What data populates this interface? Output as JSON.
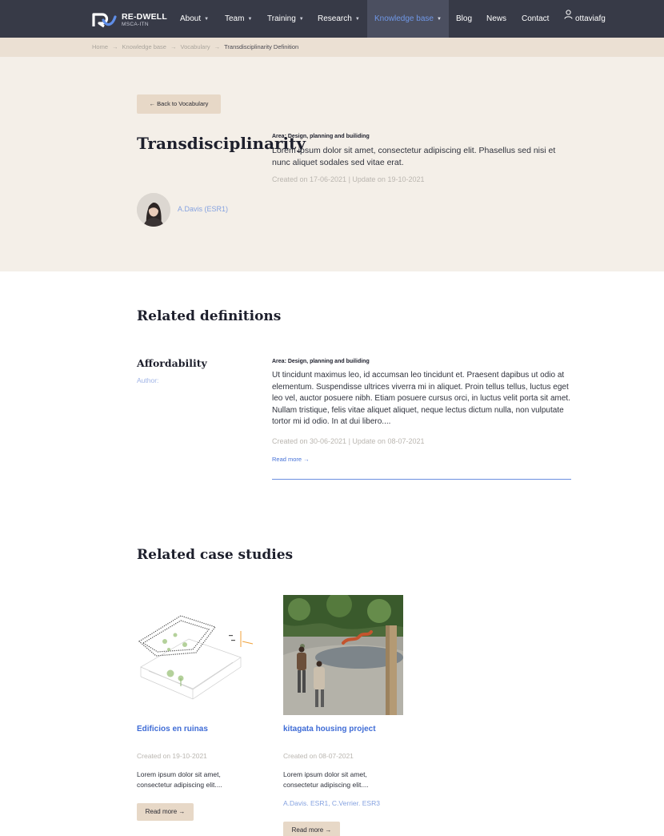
{
  "nav": {
    "brand_title": "RE-DWELL",
    "brand_subtitle": "MSCA-ITN",
    "items": [
      {
        "label": "About"
      },
      {
        "label": "Team"
      },
      {
        "label": "Training"
      },
      {
        "label": "Research"
      },
      {
        "label": "Knowledge base"
      },
      {
        "label": "Blog"
      },
      {
        "label": "News"
      },
      {
        "label": "Contact"
      }
    ],
    "dropdown_caret": "▼",
    "user_icon": "user-icon",
    "user": "ottaviafg",
    "colors": {
      "bar": "#373a47",
      "active_text": "#6f97e6"
    }
  },
  "breadcrumb": {
    "items": [
      "Home",
      "Knowledge base",
      "Vocabulary",
      "Transdisciplinarity Definition"
    ],
    "separator": "→"
  },
  "term": {
    "back_label": "← Back to Vocabulary",
    "title": "Transdisciplinarity",
    "area": "Area: Design, planning and builiding",
    "description": "Lorem ipsum dolor sit amet, consectetur adipiscing elit. Phasellus sed nisi et nunc aliquet sodales sed vitae erat.",
    "dates": "Created on 17-06-2021 | Update on 19-10-2021",
    "author": "A.Davis (ESR1)"
  },
  "related_definitions": {
    "heading": "Related definitions",
    "items": [
      {
        "title": "Affordability",
        "author_label": "Author:",
        "area": "Area: Design, planning and builiding",
        "text": "Ut tincidunt maximus leo, id accumsan leo tincidunt et. Praesent dapibus ut odio at elementum. Suspendisse ultrices viverra mi in aliquet. Proin tellus tellus, luctus eget leo vel, auctor posuere nibh. Etiam posuere cursus orci, in luctus velit porta sit amet. Nullam tristique, felis vitae aliquet aliquet, neque lectus dictum nulla, non vulputate tortor mi id odio. In at dui libero....",
        "dates": "Created on 30-06-2021 | Update on 08-07-2021",
        "read_more": "Read more →"
      }
    ]
  },
  "related_case_studies": {
    "heading": "Related case studies",
    "items": [
      {
        "title": "Edificios en ruinas",
        "date": "Created on 19-10-2021",
        "text": "Lorem ipsum dolor sit amet, consectetur adipiscing elit....",
        "authors": "",
        "button": "Read more →"
      },
      {
        "title": "kitagata housing project",
        "date": "Created on 08-07-2021",
        "text": "Lorem ipsum dolor sit amet, consectetur adipiscing elit....",
        "authors": "A.Davis. ESR1, C.Verrier. ESR3",
        "button": "Read more →"
      }
    ]
  }
}
